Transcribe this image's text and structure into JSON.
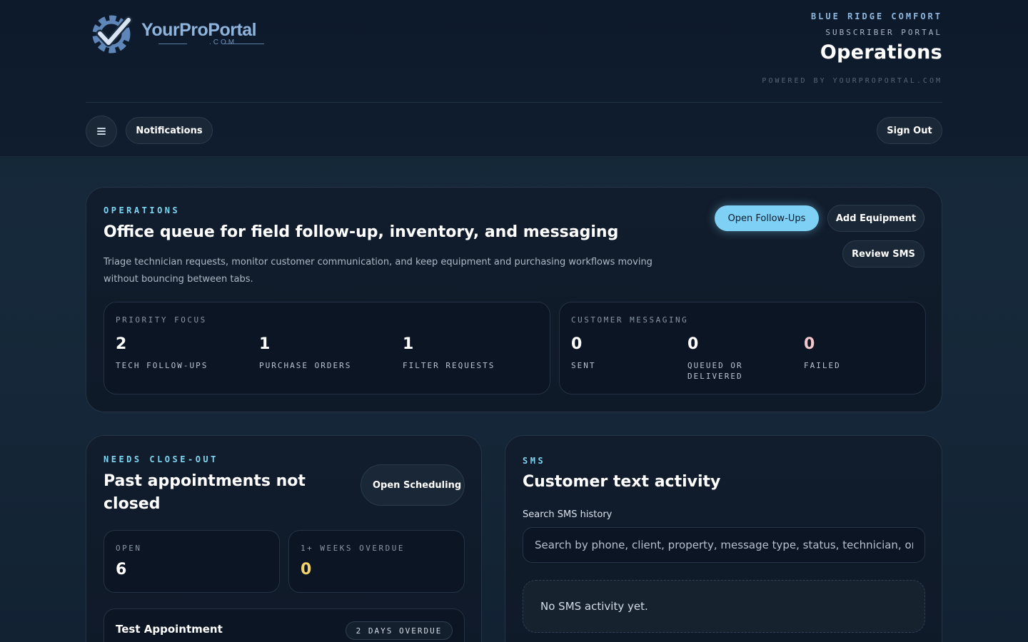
{
  "header": {
    "logo_text": "YourProPortal",
    "logo_sub": ".COM",
    "company": "BLUE RIDGE COMFORT",
    "portal_label": "SUBSCRIBER PORTAL",
    "page_title": "Operations",
    "powered_by": "POWERED BY YOURPROPORTAL.COM"
  },
  "toolbar": {
    "notifications_label": "Notifications",
    "sign_out_label": "Sign Out"
  },
  "operations": {
    "eyebrow": "OPERATIONS",
    "title": "Office queue for field follow-up, inventory, and messaging",
    "description": "Triage technician requests, monitor customer communication, and keep equipment and purchasing workflows moving without bouncing between tabs.",
    "buttons": {
      "open_followups": "Open Follow-Ups",
      "add_equipment": "Add Equipment",
      "review_sms": "Review SMS"
    },
    "priority": {
      "label": "PRIORITY FOCUS",
      "stats": [
        {
          "value": "2",
          "caption": "TECH FOLLOW-UPS"
        },
        {
          "value": "1",
          "caption": "PURCHASE ORDERS"
        },
        {
          "value": "1",
          "caption": "FILTER REQUESTS"
        }
      ]
    },
    "messaging": {
      "label": "CUSTOMER MESSAGING",
      "stats": [
        {
          "value": "0",
          "caption": "SENT"
        },
        {
          "value": "0",
          "caption": "QUEUED OR DELIVERED"
        },
        {
          "value": "0",
          "caption": "FAILED"
        }
      ]
    }
  },
  "closeout": {
    "eyebrow": "NEEDS CLOSE-OUT",
    "title": "Past appointments not closed",
    "open_scheduling_label": "Open Scheduling",
    "open": {
      "label": "OPEN",
      "value": "6"
    },
    "overdue": {
      "label": "1+ WEEKS OVERDUE",
      "value": "0"
    },
    "appointments": [
      {
        "name": "Test Appointment",
        "badge": "2 DAYS OVERDUE"
      }
    ]
  },
  "sms": {
    "eyebrow": "SMS",
    "title": "Customer text activity",
    "search_label": "Search SMS history",
    "search_placeholder": "Search by phone, client, property, message type, status, technician, or message",
    "empty_text": "No SMS activity yet."
  },
  "colors": {
    "accent": "#7fd6f2",
    "primary_button": "#7fd0f5",
    "warning_value": "#f2d36b",
    "failed_value": "#f3c6cc"
  },
  "icons": {
    "logo": "gear-check-icon",
    "menu": "hamburger-menu-icon"
  }
}
